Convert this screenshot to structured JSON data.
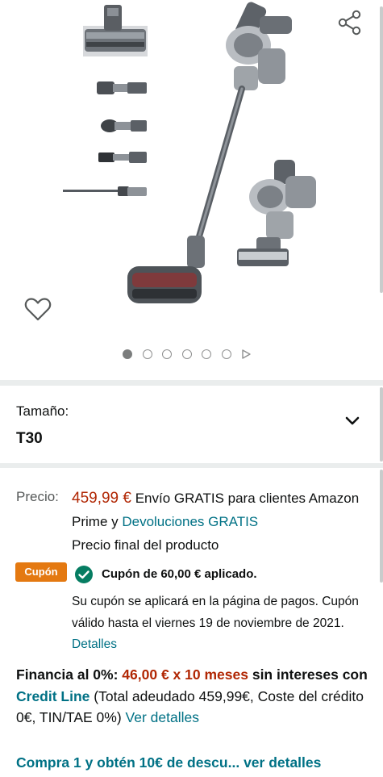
{
  "gallery": {
    "carousel": {
      "total_images": 6,
      "active_index": 0,
      "has_video": true
    },
    "icons": {
      "share": "share-icon",
      "wishlist": "heart-icon",
      "video": "play-icon"
    }
  },
  "size_selector": {
    "label": "Tamaño:",
    "value": "T30",
    "icon": "chevron-down-icon"
  },
  "price": {
    "label": "Precio:",
    "amount": "459,99 €",
    "shipping_text": " Envío GRATIS para clientes Amazon Prime y ",
    "returns_link": "Devoluciones GRATIS",
    "final_note": "Precio final del producto"
  },
  "coupon": {
    "badge": "Cupón",
    "applied": "Cupón de 60,00 € aplicado.",
    "info": "Su cupón se aplicará en la página de pagos. Cupón válido hasta el viernes 19 de noviembre de 2021. ",
    "details_link": "Detalles"
  },
  "financing": {
    "lead": "Financia al 0%: ",
    "amount": "46,00 € x 10 meses",
    "mid": " sin intereses con ",
    "credit_link": "Credit Line",
    "terms": " (Total adeudado 459,99€, Coste del crédito 0€, TIN/TAE 0%) ",
    "details_link": "Ver detalles"
  },
  "promo": {
    "text": "Compra 1 y obtén 10€ de descu",
    "ellipsis": "...",
    "details_link": "ver detalles"
  },
  "colors": {
    "price_red": "#b12704",
    "link_teal": "#007185",
    "coupon_orange": "#e47911",
    "check_green": "#067d62",
    "divider_gray": "#eaeded"
  }
}
